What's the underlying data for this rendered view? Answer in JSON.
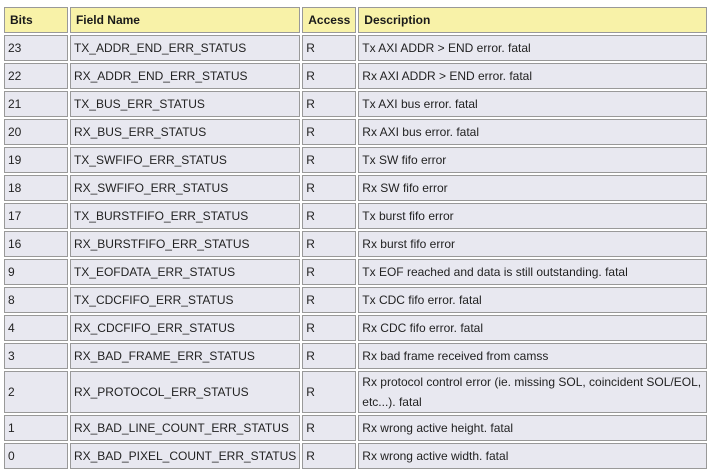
{
  "table": {
    "headers": {
      "bits": "Bits",
      "field_name": "Field Name",
      "access": "Access",
      "description": "Description"
    },
    "rows": [
      {
        "bits": "23",
        "field_name": "TX_ADDR_END_ERR_STATUS",
        "access": "R",
        "description": "Tx AXI ADDR > END error. fatal"
      },
      {
        "bits": "22",
        "field_name": "RX_ADDR_END_ERR_STATUS",
        "access": "R",
        "description": "Rx AXI ADDR > END error. fatal"
      },
      {
        "bits": "21",
        "field_name": "TX_BUS_ERR_STATUS",
        "access": "R",
        "description": "Tx AXI bus error. fatal"
      },
      {
        "bits": "20",
        "field_name": "RX_BUS_ERR_STATUS",
        "access": "R",
        "description": "Rx AXI bus error. fatal"
      },
      {
        "bits": "19",
        "field_name": "TX_SWFIFO_ERR_STATUS",
        "access": "R",
        "description": "Tx SW fifo error"
      },
      {
        "bits": "18",
        "field_name": "RX_SWFIFO_ERR_STATUS",
        "access": "R",
        "description": "Rx SW fifo error"
      },
      {
        "bits": "17",
        "field_name": "TX_BURSTFIFO_ERR_STATUS",
        "access": "R",
        "description": "Tx burst fifo error"
      },
      {
        "bits": "16",
        "field_name": "RX_BURSTFIFO_ERR_STATUS",
        "access": "R",
        "description": "Rx burst fifo error"
      },
      {
        "bits": "9",
        "field_name": "TX_EOFDATA_ERR_STATUS",
        "access": "R",
        "description": "Tx EOF reached and data is still outstanding. fatal"
      },
      {
        "bits": "8",
        "field_name": "TX_CDCFIFO_ERR_STATUS",
        "access": "R",
        "description": "Tx CDC fifo error. fatal"
      },
      {
        "bits": "4",
        "field_name": "RX_CDCFIFO_ERR_STATUS",
        "access": "R",
        "description": "Rx CDC fifo error. fatal"
      },
      {
        "bits": "3",
        "field_name": "RX_BAD_FRAME_ERR_STATUS",
        "access": "R",
        "description": "Rx bad frame received from camss"
      },
      {
        "bits": "2",
        "field_name": "RX_PROTOCOL_ERR_STATUS",
        "access": "R",
        "description": "Rx protocol control error (ie. missing SOL, coincident SOL/EOL, etc...). fatal"
      },
      {
        "bits": "1",
        "field_name": "RX_BAD_LINE_COUNT_ERR_STATUS",
        "access": "R",
        "description": "Rx wrong active height. fatal"
      },
      {
        "bits": "0",
        "field_name": "RX_BAD_PIXEL_COUNT_ERR_STATUS",
        "access": "R",
        "description": "Rx wrong active width. fatal"
      }
    ]
  },
  "colors": {
    "header_bg": "#f8f2a8",
    "cell_bg": "#e8e8f0",
    "border": "#999999"
  }
}
